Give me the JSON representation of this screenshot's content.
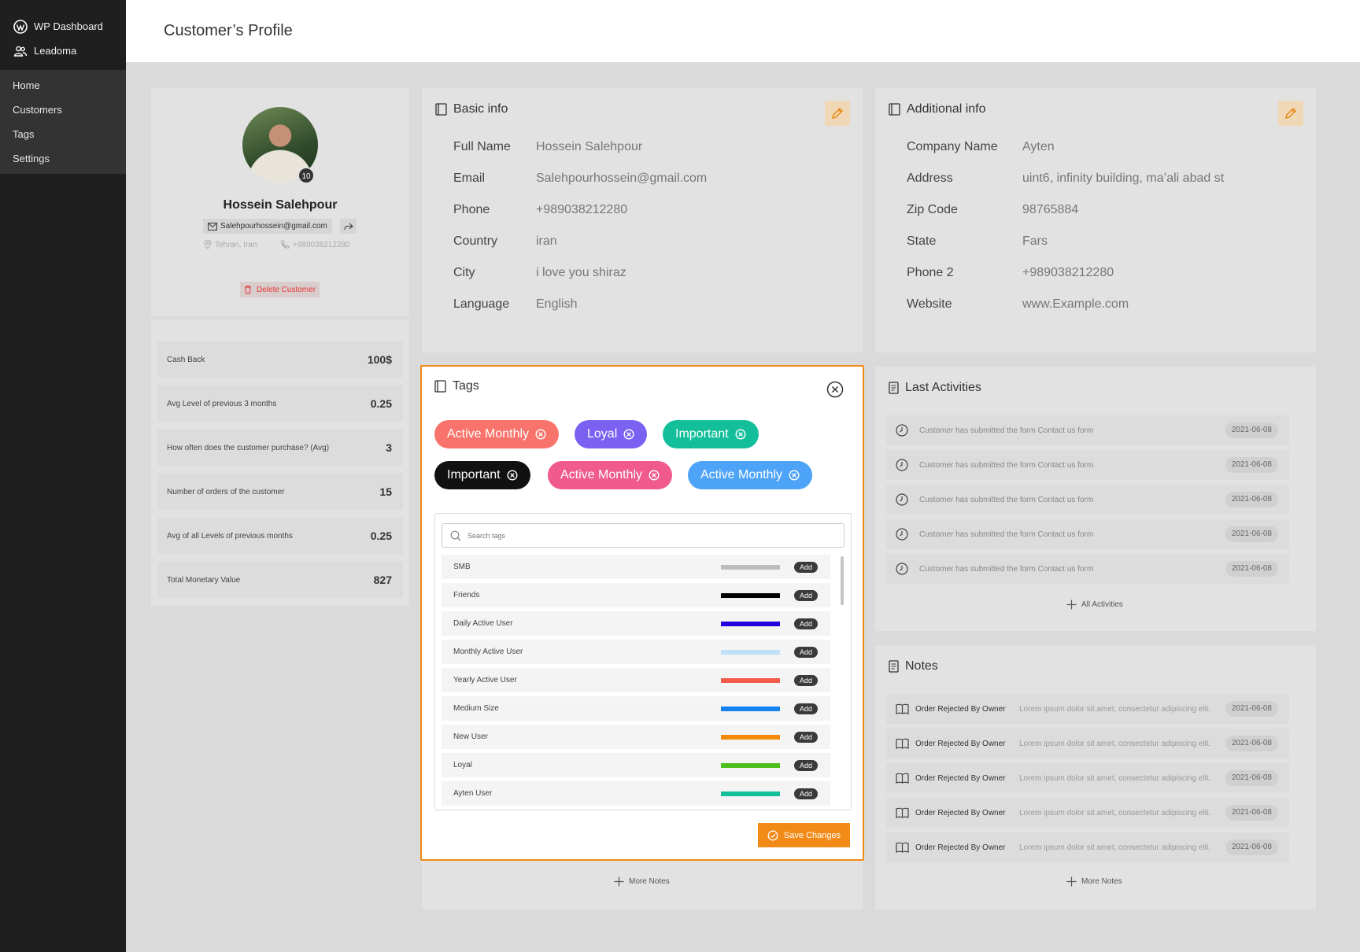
{
  "sidebar": {
    "wp_label": "WP Dashboard",
    "app_label": "Leadoma",
    "items": [
      {
        "label": "Home"
      },
      {
        "label": "Customers"
      },
      {
        "label": "Tags"
      },
      {
        "label": "Settings"
      }
    ]
  },
  "page": {
    "title": "Customer’s Profile"
  },
  "profile": {
    "name": "Hossein Salehpour",
    "email": "Salehpourhossein@gmail.com",
    "location": "Tehran, Iran",
    "phone": "+989038212280",
    "badge": "10",
    "delete_label": "Delete Customer"
  },
  "stats": [
    {
      "label": "Cash Back",
      "value": "100$"
    },
    {
      "label": "Avg Level of previous 3 months",
      "value": "0.25"
    },
    {
      "label": "How often does the customer purchase? (Avg)",
      "value": "3"
    },
    {
      "label": "Number of orders of the customer",
      "value": "15"
    },
    {
      "label": "Avg of all Levels of previous months",
      "value": "0.25"
    },
    {
      "label": "Total Monetary Value",
      "value": "827"
    }
  ],
  "basic_info": {
    "title": "Basic info",
    "fields": [
      {
        "key": "Full Name",
        "value": "Hossein Salehpour"
      },
      {
        "key": "Email",
        "value": "Salehpourhossein@gmail.com"
      },
      {
        "key": "Phone",
        "value": "+989038212280"
      },
      {
        "key": "Country",
        "value": "iran"
      },
      {
        "key": "City",
        "value": "i love you shiraz"
      },
      {
        "key": "Language",
        "value": "English"
      }
    ]
  },
  "additional_info": {
    "title": "Additional info",
    "fields": [
      {
        "key": "Company Name",
        "value": "Ayten"
      },
      {
        "key": "Address",
        "value": "uint6, infinity building, ma’ali abad st"
      },
      {
        "key": "Zip Code",
        "value": "98765884"
      },
      {
        "key": "State",
        "value": "Fars"
      },
      {
        "key": "Phone 2",
        "value": "+989038212280"
      },
      {
        "key": "Website",
        "value": "www.Example.com"
      }
    ]
  },
  "tags_modal": {
    "title": "Tags",
    "chips": [
      {
        "label": "Active Monthly",
        "color": "#f8736b"
      },
      {
        "label": "Loyal",
        "color": "#7b61f2"
      },
      {
        "label": "Important",
        "color": "#13bf9a"
      },
      {
        "label": "Important",
        "color": "#111111"
      },
      {
        "label": "Active Monthly",
        "color": "#f05a8c"
      },
      {
        "label": "Active Monthly",
        "color": "#4da3f7"
      }
    ],
    "search_placeholder": "Search tags",
    "add_label": "Add",
    "tags": [
      {
        "name": "SMB",
        "color": "#bdbdbd"
      },
      {
        "name": "Friends",
        "color": "#000000"
      },
      {
        "name": "Daily Active User",
        "color": "#2200dd"
      },
      {
        "name": "Monthly Active User",
        "color": "#bfe0f7"
      },
      {
        "name": "Yearly Active User",
        "color": "#f25b4a"
      },
      {
        "name": "Medium Size",
        "color": "#1582f2"
      },
      {
        "name": "New User",
        "color": "#f58a0a"
      },
      {
        "name": "Loyal",
        "color": "#4cbf1c"
      },
      {
        "name": "Ayten User",
        "color": "#12bf9a"
      }
    ],
    "save_label": "Save Changes"
  },
  "last_activities": {
    "title": "Last Activities",
    "items": [
      {
        "text": "Customer has submitted the form Contact us form",
        "date": "2021-06-08"
      },
      {
        "text": "Customer has submitted the form Contact us form",
        "date": "2021-06-08"
      },
      {
        "text": "Customer has submitted the form Contact us form",
        "date": "2021-06-08"
      },
      {
        "text": "Customer has submitted the form Contact us form",
        "date": "2021-06-08"
      },
      {
        "text": "Customer has submitted the form Contact us form",
        "date": "2021-06-08"
      }
    ],
    "all_label": "All Activities"
  },
  "notes": {
    "title": "Notes",
    "items": [
      {
        "title": "Order Rejected By Owner",
        "desc": "Lorem ipsum dolor sit amet, consectetur adipiscing elit.",
        "date": "2021-06-08"
      },
      {
        "title": "Order Rejected By Owner",
        "desc": "Lorem ipsum dolor sit amet, consectetur adipiscing elit.",
        "date": "2021-06-08"
      },
      {
        "title": "Order Rejected By Owner",
        "desc": "Lorem ipsum dolor sit amet, consectetur adipiscing elit.",
        "date": "2021-06-08"
      },
      {
        "title": "Order Rejected By Owner",
        "desc": "Lorem ipsum dolor sit amet, consectetur adipiscing elit.",
        "date": "2021-06-08"
      },
      {
        "title": "Order Rejected By Owner",
        "desc": "Lorem ipsum dolor sit amet, consectetur adipiscing elit.",
        "date": "2021-06-08"
      }
    ],
    "more_label": "More Notes"
  },
  "bottom_more_label": "More Notes"
}
